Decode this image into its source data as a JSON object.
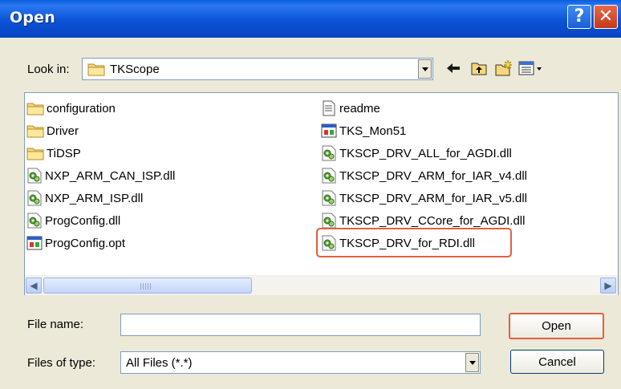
{
  "window": {
    "title": "Open",
    "help_glyph": "?",
    "close_glyph": "✕"
  },
  "look_in": {
    "label": "Look in:",
    "value": "TKScope",
    "icon": "folder-icon"
  },
  "toolbar": {
    "icons": [
      "back-arrow-icon",
      "up-folder-icon",
      "new-folder-icon",
      "view-menu-icon"
    ]
  },
  "files": {
    "left": [
      {
        "name": "configuration",
        "icon": "folder-icon"
      },
      {
        "name": "Driver",
        "icon": "folder-icon"
      },
      {
        "name": "TiDSP",
        "icon": "folder-icon"
      },
      {
        "name": "NXP_ARM_CAN_ISP.dll",
        "icon": "dll-icon"
      },
      {
        "name": "NXP_ARM_ISP.dll",
        "icon": "dll-icon"
      },
      {
        "name": "ProgConfig.dll",
        "icon": "dll-icon"
      },
      {
        "name": "ProgConfig.opt",
        "icon": "opt-icon"
      }
    ],
    "right": [
      {
        "name": "readme",
        "icon": "text-file-icon"
      },
      {
        "name": "TKS_Mon51",
        "icon": "opt-icon"
      },
      {
        "name": "TKSCP_DRV_ALL_for_AGDI.dll",
        "icon": "dll-icon"
      },
      {
        "name": "TKSCP_DRV_ARM_for_IAR_v4.dll",
        "icon": "dll-icon"
      },
      {
        "name": "TKSCP_DRV_ARM_for_IAR_v5.dll",
        "icon": "dll-icon"
      },
      {
        "name": "TKSCP_DRV_CCore_for_AGDI.dll",
        "icon": "dll-icon"
      },
      {
        "name": "TKSCP_DRV_for_RDI.dll",
        "icon": "dll-icon"
      }
    ],
    "highlighted": "TKSCP_DRV_for_RDI.dll"
  },
  "scrollbar": {
    "grip": "III"
  },
  "file_name": {
    "label": "File name:",
    "value": ""
  },
  "file_type": {
    "label": "Files of type:",
    "value": "All Files (*.*)"
  },
  "buttons": {
    "open": "Open",
    "cancel": "Cancel"
  },
  "colors": {
    "title_bar": "#0b53d6",
    "dialog_bg": "#ece9d8",
    "highlight": "#e2603e"
  }
}
